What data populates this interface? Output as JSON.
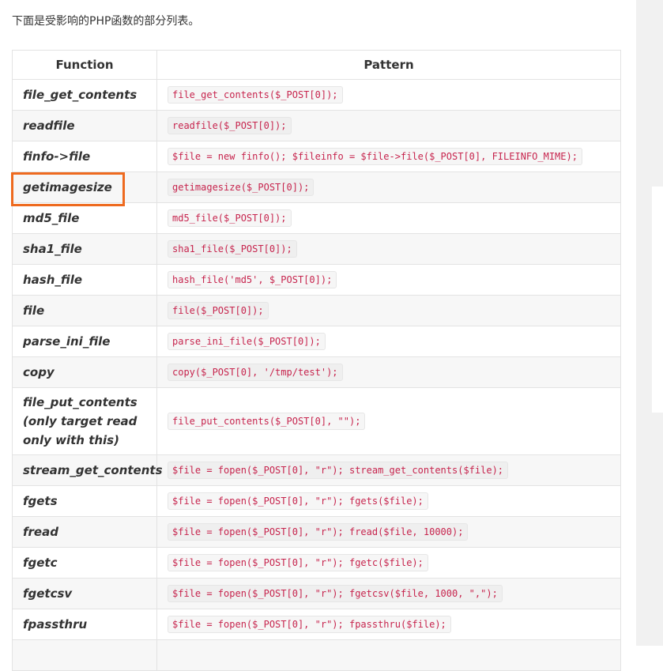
{
  "intro": "下面是受影响的PHP函数的部分列表。",
  "table": {
    "headers": [
      "Function",
      "Pattern"
    ],
    "rows": [
      {
        "function": "file_get_contents",
        "pattern": "file_get_contents($_POST[0]);"
      },
      {
        "function": "readfile",
        "pattern": "readfile($_POST[0]);"
      },
      {
        "function": "finfo->file",
        "pattern": "$file = new finfo(); $fileinfo = $file->file($_POST[0], FILEINFO_MIME);"
      },
      {
        "function": "getimagesize",
        "pattern": "getimagesize($_POST[0]);"
      },
      {
        "function": "md5_file",
        "pattern": "md5_file($_POST[0]);"
      },
      {
        "function": "sha1_file",
        "pattern": "sha1_file($_POST[0]);"
      },
      {
        "function": "hash_file",
        "pattern": "hash_file('md5', $_POST[0]);"
      },
      {
        "function": "file",
        "pattern": "file($_POST[0]);"
      },
      {
        "function": "parse_ini_file",
        "pattern": "parse_ini_file($_POST[0]);"
      },
      {
        "function": "copy",
        "pattern": "copy($_POST[0], '/tmp/test');"
      },
      {
        "function": "file_put_contents (only target read only with this)",
        "pattern": "file_put_contents($_POST[0], \"\");"
      },
      {
        "function": "stream_get_contents",
        "pattern": "$file = fopen($_POST[0], \"r\"); stream_get_contents($file);"
      },
      {
        "function": "fgets",
        "pattern": "$file = fopen($_POST[0], \"r\"); fgets($file);"
      },
      {
        "function": "fread",
        "pattern": "$file = fopen($_POST[0], \"r\"); fread($file, 10000);"
      },
      {
        "function": "fgetc",
        "pattern": "$file = fopen($_POST[0], \"r\"); fgetc($file);"
      },
      {
        "function": "fgetcsv",
        "pattern": "$file = fopen($_POST[0], \"r\"); fgetcsv($file, 1000, \",\");"
      },
      {
        "function": "fpassthru",
        "pattern": "$file = fopen($_POST[0], \"r\"); fpassthru($file);"
      }
    ]
  },
  "colors": {
    "highlight": "#ee6a1f",
    "code_text": "#c7254e"
  }
}
